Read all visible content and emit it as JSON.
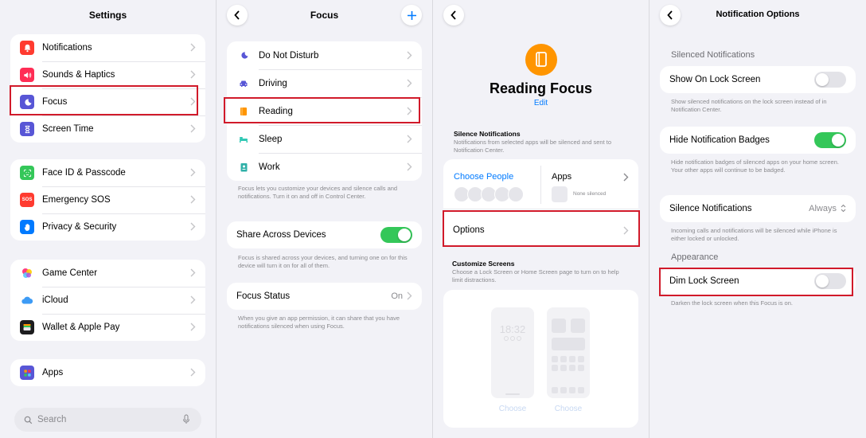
{
  "screen1": {
    "title": "Settings",
    "groups": [
      [
        {
          "label": "Notifications",
          "color": "#ff3b30",
          "icon": "bell-icon"
        },
        {
          "label": "Sounds & Haptics",
          "color": "#ff2d55",
          "icon": "speaker-icon"
        },
        {
          "label": "Focus",
          "color": "#5856d6",
          "icon": "moon-icon"
        },
        {
          "label": "Screen Time",
          "color": "#5856d6",
          "icon": "hourglass-icon"
        }
      ],
      [
        {
          "label": "Face ID & Passcode",
          "color": "#34c759",
          "icon": "face-id-icon"
        },
        {
          "label": "Emergency SOS",
          "color": "#ff3b30",
          "icon": "sos-icon",
          "badge": "SOS"
        },
        {
          "label": "Privacy & Security",
          "color": "#007aff",
          "icon": "hand-icon"
        }
      ],
      [
        {
          "label": "Game Center",
          "color": "#ffffff",
          "icon": "game-center-icon"
        },
        {
          "label": "iCloud",
          "color": "#ffffff",
          "icon": "cloud-icon"
        },
        {
          "label": "Wallet & Apple Pay",
          "color": "#1c1c1e",
          "icon": "wallet-icon"
        }
      ],
      [
        {
          "label": "Apps",
          "color": "#5856d6",
          "icon": "apps-grid-icon"
        }
      ]
    ],
    "search_placeholder": "Search"
  },
  "screen2": {
    "title": "Focus",
    "modes": [
      {
        "label": "Do Not Disturb",
        "color": "#5856d6",
        "icon": "moon-icon"
      },
      {
        "label": "Driving",
        "color": "#5856d6",
        "icon": "car-icon"
      },
      {
        "label": "Reading",
        "color": "#ff9500",
        "icon": "book-icon"
      },
      {
        "label": "Sleep",
        "color": "#30c8b4",
        "icon": "bed-icon"
      },
      {
        "label": "Work",
        "color": "#30b0a8",
        "icon": "badge-icon"
      }
    ],
    "modes_footnote": "Focus lets you customize your devices and silence calls and notifications. Turn it on and off in Control Center.",
    "share_label": "Share Across Devices",
    "share_on": true,
    "share_footnote": "Focus is shared across your devices, and turning one on for this device will turn it on for all of them.",
    "status_label": "Focus Status",
    "status_value": "On",
    "status_footnote": "When you give an app permission, it can share that you have notifications silenced when using Focus."
  },
  "screen3": {
    "title": "Reading Focus",
    "edit_label": "Edit",
    "accent": "#ff9500",
    "silence_head": "Silence Notifications",
    "silence_sub": "Notifications from selected apps will be silenced and sent to Notification Center.",
    "choose_people": "Choose People",
    "apps_label": "Apps",
    "none_silenced": "None silenced",
    "options_label": "Options",
    "customize_head": "Customize Screens",
    "customize_sub": "Choose a Lock Screen or Home Screen page to turn on to help limit distractions.",
    "lock_time": "18:32",
    "choose_lock": "Choose",
    "choose_home": "Choose"
  },
  "screen4": {
    "title": "Notification Options",
    "silenced_head": "Silenced Notifications",
    "show_lock_label": "Show On Lock Screen",
    "show_lock_on": false,
    "show_lock_foot": "Show silenced notifications on the lock screen instead of in Notification Center.",
    "hide_badges_label": "Hide Notification Badges",
    "hide_badges_on": true,
    "hide_badges_foot": "Hide notification badges of silenced apps on your home screen. Your other apps will continue to be badged.",
    "silence_label": "Silence Notifications",
    "silence_value": "Always",
    "silence_foot": "Incoming calls and notifications will be silenced while iPhone is either locked or unlocked.",
    "appearance_head": "Appearance",
    "dim_label": "Dim Lock Screen",
    "dim_on": false,
    "dim_foot": "Darken the lock screen when this Focus is on."
  }
}
